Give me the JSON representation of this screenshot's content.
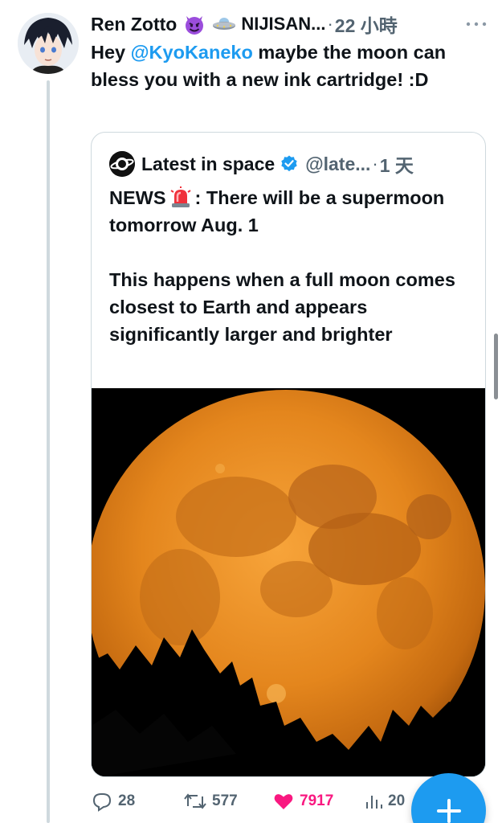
{
  "tweet": {
    "author_name": "Ren Zotto",
    "author_name_2": "NIJISAN...",
    "separator": "·",
    "time": "22 小時",
    "text_before": "Hey ",
    "mention": "@KyoKaneko",
    "text_after": " maybe the moon can bless you with a new ink cartridge! :D"
  },
  "quote": {
    "author_name": "Latest in space",
    "handle": "@late...",
    "separator": "·",
    "time": "1 天",
    "text_line1_a": "NEWS",
    "text_line1_b": ": There will be a supermoon tomorrow Aug. 1",
    "text_para2": "This happens when a full moon comes closest to Earth and appears significantly larger and brighter"
  },
  "actions": {
    "replies": "28",
    "retweets": "577",
    "likes": "7917",
    "views": "20"
  },
  "colors": {
    "accent": "#1d9bf0",
    "like": "#f91880",
    "secondary": "#536471"
  },
  "icons": [
    "devil-emoji-icon",
    "ufo-emoji-icon",
    "more-icon",
    "verified-icon",
    "siren-emoji-icon",
    "reply-icon",
    "retweet-icon",
    "heart-icon",
    "views-icon",
    "plus-icon"
  ]
}
